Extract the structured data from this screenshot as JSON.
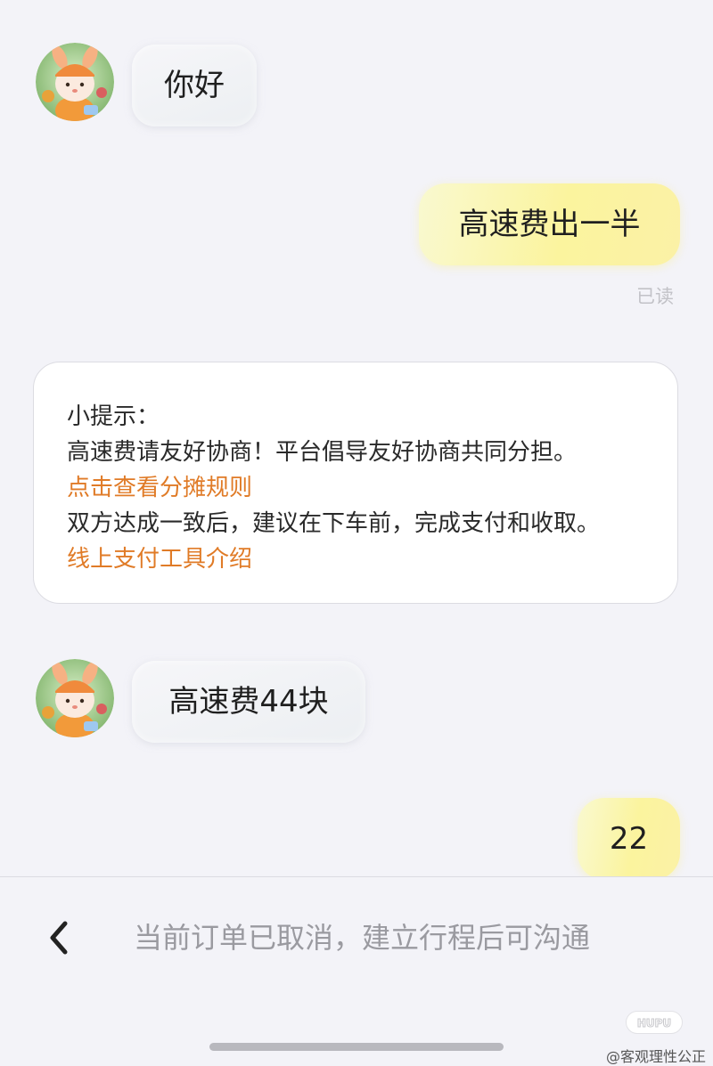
{
  "messages": [
    {
      "side": "incoming",
      "text": "你好"
    },
    {
      "side": "outgoing",
      "text": "高速费出一半",
      "read_receipt": "已读"
    },
    {
      "side": "incoming",
      "text": "高速费44块"
    },
    {
      "side": "outgoing",
      "text": "22"
    }
  ],
  "tip": {
    "title": "小提示：",
    "line1": "高速费请友好协商！平台倡导友好协商共同分担。",
    "link1": "点击查看分摊规则",
    "line2": "双方达成一致后，建议在下车前，完成支付和收取。",
    "link2": "线上支付工具介绍"
  },
  "bottom_bar": {
    "back_icon": "chevron-left-icon",
    "status_text": "当前订单已取消，建立行程后可沟通"
  },
  "watermark": {
    "brand": "HUPU",
    "text": "@客观理性公正"
  },
  "colors": {
    "background": "#f3f3f8",
    "outgoing_bubble": "#fbf49e",
    "incoming_bubble": "#eceff2",
    "link": "#e07b27",
    "status_text": "#9a9aa0"
  }
}
